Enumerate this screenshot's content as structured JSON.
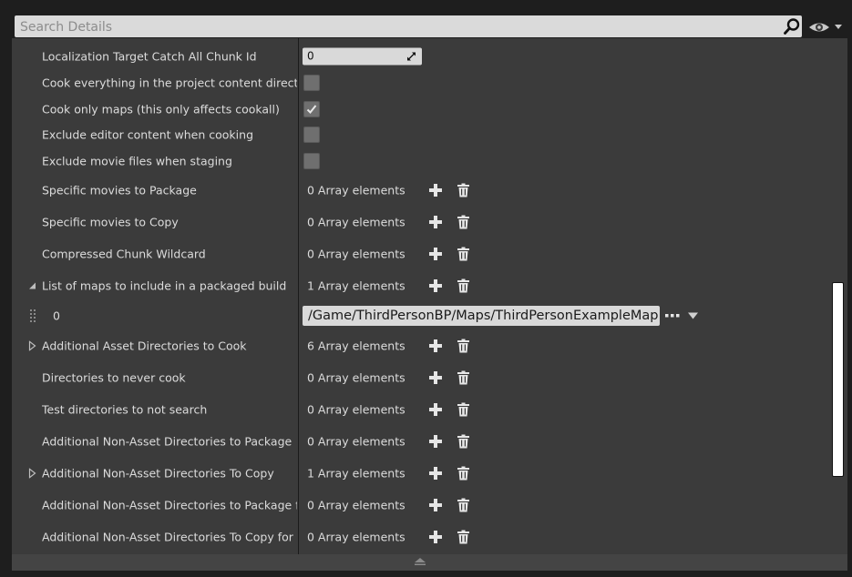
{
  "search": {
    "placeholder": "Search Details"
  },
  "icons": {
    "search": "search-icon",
    "eye": "eye-icon",
    "add": "plus-icon",
    "delete": "trash-icon",
    "expand": "triangle-right-icon",
    "collapse": "triangle-down-icon",
    "browse": "ellipsis-icon",
    "combo": "dropdown-arrow-icon",
    "resize": "resize-icon",
    "drag": "drag-handle-icon"
  },
  "colors": {
    "background": "#1e1e1e",
    "panel": "#3b3b3b",
    "field": "#d9d9d9",
    "text": "#dcdcdc",
    "checkbox": "#6f6f6f"
  },
  "rows": [
    {
      "label": "Localization Target Catch All Chunk Id",
      "value": "0",
      "kind": "number"
    },
    {
      "label": "Cook everything in the project content directory (i",
      "checked": false,
      "kind": "checkbox"
    },
    {
      "label": "Cook only maps (this only affects cookall)",
      "checked": true,
      "kind": "checkbox"
    },
    {
      "label": "Exclude editor content when cooking",
      "checked": false,
      "kind": "checkbox"
    },
    {
      "label": "Exclude movie files when staging",
      "checked": false,
      "kind": "checkbox"
    },
    {
      "label": "Specific movies to Package",
      "value": "0 Array elements",
      "kind": "array"
    },
    {
      "label": "Specific movies to Copy",
      "value": "0 Array elements",
      "kind": "array"
    },
    {
      "label": "Compressed Chunk Wildcard",
      "value": "0 Array elements",
      "kind": "array"
    },
    {
      "label": "List of maps to include in a packaged build",
      "value": "1 Array elements",
      "kind": "array",
      "expanded": true
    },
    {
      "index": "0",
      "value": "/Game/ThirdPersonBP/Maps/ThirdPersonExampleMap",
      "kind": "path"
    },
    {
      "label": "Additional Asset Directories to Cook",
      "value": "6 Array elements",
      "kind": "array",
      "expanded": false
    },
    {
      "label": "Directories to never cook",
      "value": "0 Array elements",
      "kind": "array"
    },
    {
      "label": "Test directories to not search",
      "value": "0 Array elements",
      "kind": "array"
    },
    {
      "label": "Additional Non-Asset Directories to Package",
      "value": "0 Array elements",
      "kind": "array"
    },
    {
      "label": "Additional Non-Asset Directories To Copy",
      "value": "1 Array elements",
      "kind": "array",
      "expanded": false
    },
    {
      "label": "Additional Non-Asset Directories to Package for d",
      "value": "0 Array elements",
      "kind": "array"
    },
    {
      "label": "Additional Non-Asset Directories To Copy for ded",
      "value": "0 Array elements",
      "kind": "array"
    }
  ]
}
